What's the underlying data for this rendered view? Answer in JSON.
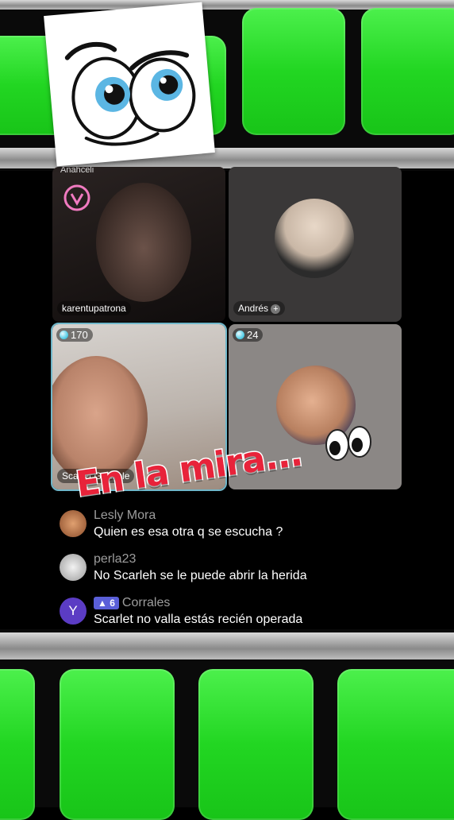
{
  "tiles": [
    {
      "name": "karentupatrona",
      "top_label": "Anahceli",
      "heart_icon": "heart-icon"
    },
    {
      "name": "Andrés",
      "add_icon": "plus-icon"
    },
    {
      "name": "Scarlet Gonzale",
      "gems": "170"
    },
    {
      "name": "",
      "gems": "24"
    }
  ],
  "overlay": {
    "title": "En la mira..."
  },
  "comments": [
    {
      "user": "Lesly Mora",
      "text": "Quien es esa otra q se escucha ?",
      "avatar_color": "#c77a3e"
    },
    {
      "user": "perla23",
      "text": "No Scarleh se le puede abrir la herida",
      "avatar_color": "#bdbdbd"
    },
    {
      "user": "Corrales",
      "badge": "6",
      "text": "Scarlet no valla estás recién operada",
      "avatar_letter": "Y",
      "avatar_color": "#5b3cc4"
    }
  ],
  "colors": {
    "green": "#22d622",
    "accent": "#e8233a",
    "gem": "#5bd0e8"
  }
}
